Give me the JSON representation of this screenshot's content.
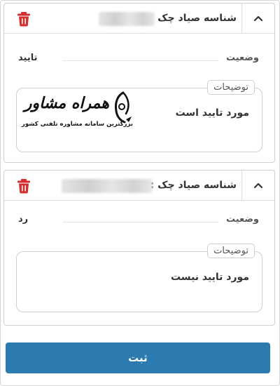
{
  "cards": [
    {
      "header_label": "شناسه صیاد چک :",
      "status_label": "وضعیت",
      "status_value": "تایید",
      "description_legend": "توضیحات",
      "description_text": "مورد تایید است"
    },
    {
      "header_label": "شناسه صیاد چک :",
      "status_label": "وضعیت",
      "status_value": "رد",
      "description_legend": "توضیحات",
      "description_text": "مورد تایید نیست"
    }
  ],
  "watermark": {
    "title": "همراه مشاور",
    "subtitle": "بزرگترین سامانه مشاوره تلفنی کشور"
  },
  "submit_label": "ثبت",
  "colors": {
    "accent": "#2b7ab0",
    "delete_red": "#d32f2f"
  },
  "icons": [
    "chevron-up-icon",
    "trash-icon",
    "logo-icon"
  ]
}
